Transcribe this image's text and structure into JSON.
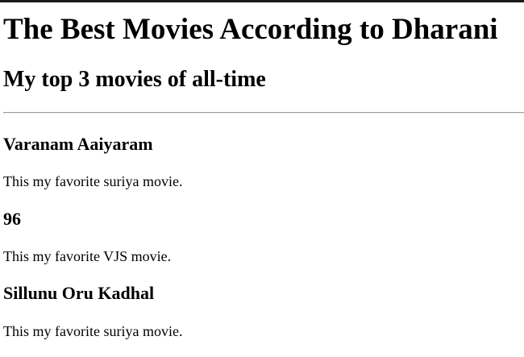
{
  "header": {
    "title": "The Best Movies According to Dharani",
    "subtitle": "My top 3 movies of all-time"
  },
  "movies": [
    {
      "title": "Varanam Aaiyaram",
      "description": "This my favorite suriya movie."
    },
    {
      "title": "96",
      "description": "This my favorite VJS movie."
    },
    {
      "title": "Sillunu Oru Kadhal",
      "description": "This my favorite suriya movie."
    }
  ]
}
